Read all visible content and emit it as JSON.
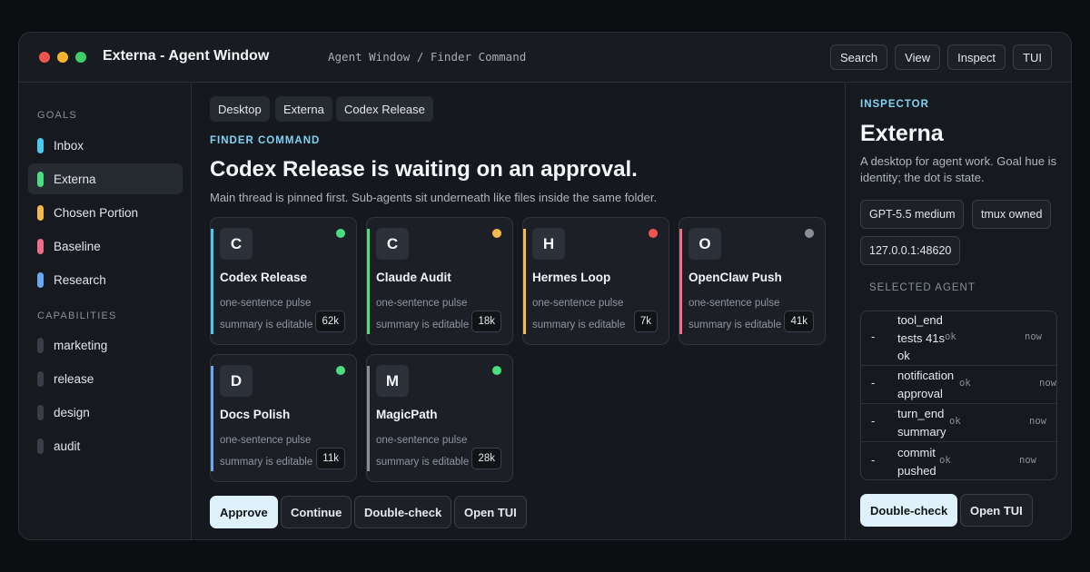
{
  "window": {
    "title": "Externa - Agent Window",
    "path": "Agent Window / Finder Command"
  },
  "titlebar_buttons": [
    "Search",
    "View",
    "Inspect",
    "TUI"
  ],
  "traffic_lights": [
    "#f0544f",
    "#f5b52e",
    "#3ecf6a"
  ],
  "sidebar": {
    "goals_heading": "GOALS",
    "goals": [
      {
        "label": "Inbox",
        "color": "#4cc9f0"
      },
      {
        "label": "Externa",
        "color": "#4ade80",
        "active": true
      },
      {
        "label": "Chosen Portion",
        "color": "#f5b84a"
      },
      {
        "label": "Baseline",
        "color": "#ef6f86"
      },
      {
        "label": "Research",
        "color": "#6aa8f7"
      }
    ],
    "capabilities_heading": "CAPABILITIES",
    "capabilities": [
      {
        "label": "marketing",
        "color": "#3a3e46"
      },
      {
        "label": "release",
        "color": "#3a3e46"
      },
      {
        "label": "design",
        "color": "#3a3e46"
      },
      {
        "label": "audit",
        "color": "#3a3e46"
      }
    ]
  },
  "main": {
    "breadcrumbs": [
      "Desktop",
      "Externa",
      "Codex Release"
    ],
    "eyebrow": "FINDER COMMAND",
    "headline": "Codex Release is waiting on an approval.",
    "subtitle": "Main thread is pinned first. Sub-agents sit underneath like files inside the same folder.",
    "cards": [
      {
        "initial": "C",
        "name": "Codex Release",
        "line1": "one-sentence pulse",
        "line2": "summary is editable",
        "count": "62k",
        "bar_color": "#4cc9f0",
        "dot_color": "#4ade80"
      },
      {
        "initial": "C",
        "name": "Claude Audit",
        "line1": "one-sentence pulse",
        "line2": "summary is editable",
        "count": "18k",
        "bar_color": "#4ade80",
        "dot_color": "#f5b84a"
      },
      {
        "initial": "H",
        "name": "Hermes Loop",
        "line1": "one-sentence pulse",
        "line2": "summary is editable",
        "count": "7k",
        "bar_color": "#f5b84a",
        "dot_color": "#f0544f"
      },
      {
        "initial": "O",
        "name": "OpenClaw Push",
        "line1": "one-sentence pulse",
        "line2": "summary is editable",
        "count": "41k",
        "bar_color": "#ef6f86",
        "dot_color": "#8a8f98"
      },
      {
        "initial": "D",
        "name": "Docs Polish",
        "line1": "one-sentence pulse",
        "line2": "summary is editable",
        "count": "11k",
        "bar_color": "#6aa8f7",
        "dot_color": "#4ade80"
      },
      {
        "initial": "M",
        "name": "MagicPath",
        "line1": "one-sentence pulse",
        "line2": "summary is editable",
        "count": "28k",
        "bar_color": "#8a8f98",
        "dot_color": "#4ade80"
      }
    ],
    "actions": [
      "Approve",
      "Continue",
      "Double-check",
      "Open TUI"
    ]
  },
  "inspector": {
    "eyebrow": "INSPECTOR",
    "title": "Externa",
    "description": "A desktop for agent work. Goal hue is identity; the dot is state.",
    "chips": [
      "GPT-5.5 medium",
      "tmux owned",
      "127.0.0.1:48620"
    ],
    "selected_label": "SELECTED AGENT",
    "log": [
      {
        "dash": "-",
        "text": "tool_end tests 41s ok",
        "status": "ok",
        "time": "now"
      },
      {
        "dash": "-",
        "text": "notification approval",
        "status": "ok",
        "time": "now"
      },
      {
        "dash": "-",
        "text": "turn_end summary",
        "status": "ok",
        "time": "now"
      },
      {
        "dash": "-",
        "text": "commit pushed",
        "status": "ok",
        "time": "now"
      }
    ],
    "actions": [
      "Double-check",
      "Open TUI"
    ]
  },
  "colors": {
    "accent": "#7fd2f5",
    "primary_button": "#dff1fb"
  }
}
